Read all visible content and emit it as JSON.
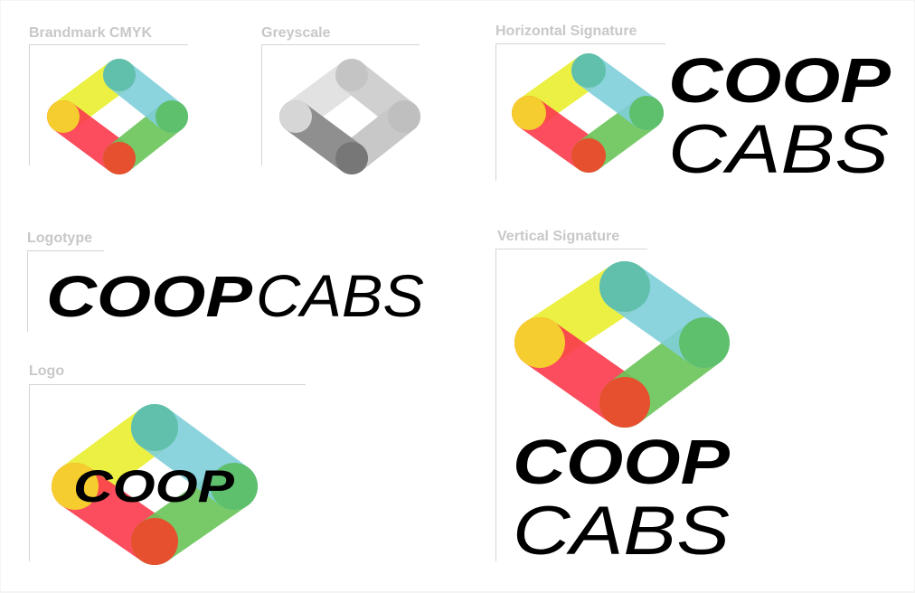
{
  "sections": {
    "brandmark_cmyk": {
      "label": "Brandmark CMYK"
    },
    "greyscale": {
      "label": "Greyscale"
    },
    "horizontal_signature": {
      "label": "Horizontal Signature",
      "line1": "COOP",
      "line2": "CABS"
    },
    "logotype": {
      "label": "Logotype",
      "word1": "COOP",
      "word2": "CABS"
    },
    "logo": {
      "label": "Logo",
      "word": "COOP"
    },
    "vertical_signature": {
      "label": "Vertical Signature",
      "line1": "COOP",
      "line2": "CABS"
    }
  },
  "colors": {
    "yellow": "#e9ef2e",
    "yellow_cap": "#f5d42c",
    "red": "#fb3a4c",
    "red_cap": "#ec4a2c",
    "green": "#6ac559",
    "green_cap": "#5dbe66",
    "teal": "#7fcfda",
    "teal_cap": "#5ebfaa",
    "grey_light": "#d8d8d8",
    "grey_mid": "#c4c4c4",
    "grey_dark": "#8a8a8a",
    "grey_darkest": "#707070",
    "label_grey": "#c8c8c8",
    "rule_grey": "#d4d4d4",
    "ink": "#000000"
  }
}
